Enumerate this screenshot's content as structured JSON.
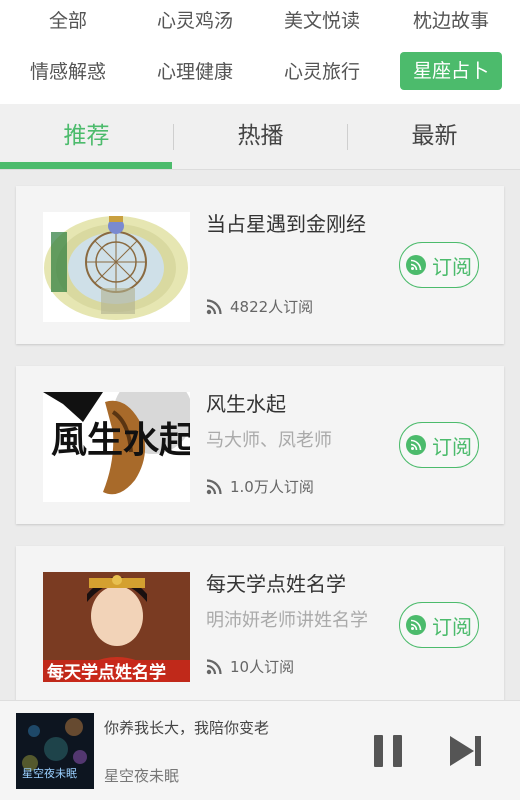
{
  "categories": [
    {
      "label": "全部"
    },
    {
      "label": "心灵鸡汤"
    },
    {
      "label": "美文悦读"
    },
    {
      "label": "枕边故事"
    },
    {
      "label": "情感解惑"
    },
    {
      "label": "心理健康"
    },
    {
      "label": "心灵旅行"
    },
    {
      "label": "星座占卜",
      "active": true
    }
  ],
  "tabs": [
    {
      "label": "推荐",
      "active": true
    },
    {
      "label": "热播"
    },
    {
      "label": "最新"
    }
  ],
  "items": [
    {
      "title": "当占星遇到金刚经",
      "subtitle": "",
      "subscribers": "4822人订阅",
      "subscribe_label": "订阅"
    },
    {
      "title": "风生水起",
      "subtitle": "马大师、凤老师",
      "subscribers": "1.0万人订阅",
      "subscribe_label": "订阅"
    },
    {
      "title": "每天学点姓名学",
      "subtitle": "明沛妍老师讲姓名学",
      "subscribers": "10人订阅",
      "subscribe_label": "订阅"
    }
  ],
  "thumb_text": {
    "item2": "風生水起",
    "item3": "每天学点姓名学",
    "player": "星空夜未眠"
  },
  "player": {
    "track": "你养我长大，我陪你变老",
    "album": "星空夜未眠"
  },
  "colors": {
    "accent": "#4cbb6c"
  }
}
